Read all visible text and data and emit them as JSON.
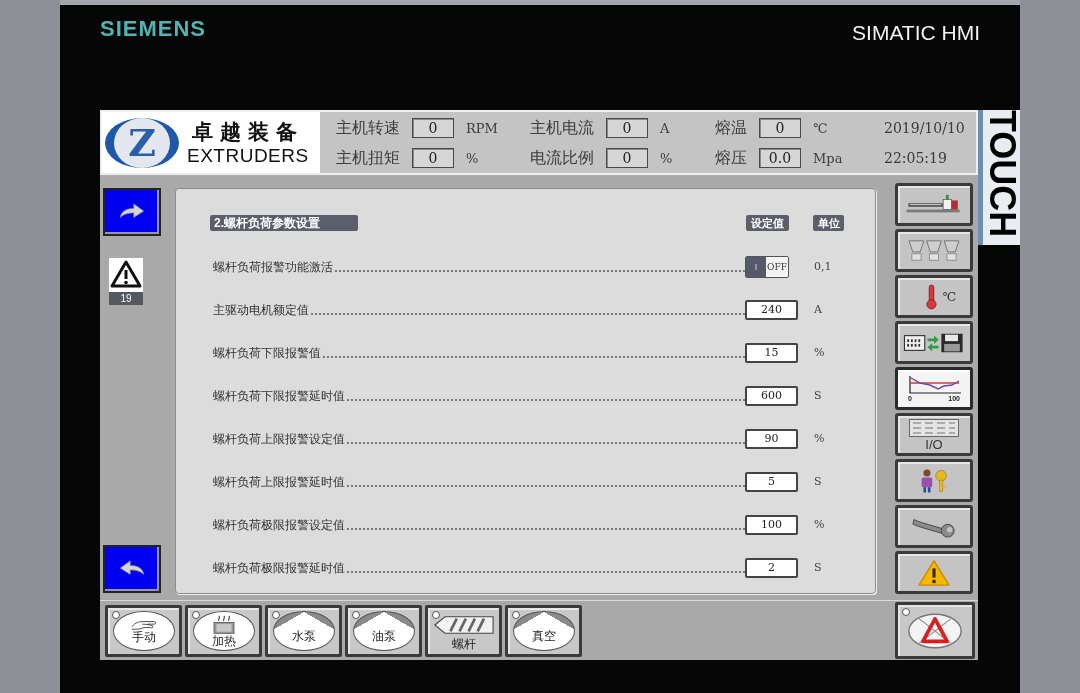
{
  "device": {
    "brand": "SIEMENS",
    "model": "SIMATIC HMI",
    "touch_label": "TOUCH"
  },
  "header": {
    "logo": {
      "mark": "Z",
      "name_cn": "卓越装备",
      "name_en": "EXTRUDERS"
    },
    "rows": [
      {
        "readings": [
          {
            "label": "主机转速",
            "value": "0",
            "unit": "RPM"
          },
          {
            "label": "主机电流",
            "value": "0",
            "unit": "A"
          },
          {
            "label": "熔温",
            "value": "0",
            "unit": "℃"
          }
        ],
        "clock": "2019/10/10"
      },
      {
        "readings": [
          {
            "label": "主机扭矩",
            "value": "0",
            "unit": "%"
          },
          {
            "label": "电流比例",
            "value": "0",
            "unit": "%"
          },
          {
            "label": "熔压",
            "value": "0.0",
            "unit": "Mpa"
          }
        ],
        "clock": "22:05:19"
      }
    ]
  },
  "left_nav": {
    "alarm_count": "19"
  },
  "panel": {
    "title": "2.螺杆负荷参数设置",
    "columns": [
      "设定值",
      "单位"
    ],
    "rows": [
      {
        "kind": "toggle",
        "label": "螺杆负荷报警功能激活",
        "on_text": "I",
        "off_text": "OFF",
        "on": false,
        "unit": "0,1"
      },
      {
        "kind": "value",
        "label": "主驱动电机额定值",
        "value": "240",
        "unit": "A"
      },
      {
        "kind": "value",
        "label": "螺杆负荷下限报警值",
        "value": "15",
        "unit": "%"
      },
      {
        "kind": "value",
        "label": "螺杆负荷下限报警延时值",
        "value": "600",
        "unit": "S"
      },
      {
        "kind": "value",
        "label": "螺杆负荷上限报警设定值",
        "value": "90",
        "unit": "%"
      },
      {
        "kind": "value",
        "label": "螺杆负荷上限报警延时值",
        "value": "5",
        "unit": "S"
      },
      {
        "kind": "value",
        "label": "螺杆负荷极限报警设定值",
        "value": "100",
        "unit": "%"
      },
      {
        "kind": "value",
        "label": "螺杆负荷极限报警延时值",
        "value": "2",
        "unit": "S"
      }
    ]
  },
  "right_nav": [
    {
      "kind": "extruder",
      "selected": false
    },
    {
      "kind": "hoppers",
      "selected": false
    },
    {
      "kind": "temperature",
      "selected": false,
      "label": "℃"
    },
    {
      "kind": "recipe",
      "selected": false
    },
    {
      "kind": "trend",
      "selected": true,
      "labels": [
        "0",
        "100"
      ]
    },
    {
      "kind": "io",
      "selected": false,
      "label": "I/O"
    },
    {
      "kind": "user",
      "selected": false
    },
    {
      "kind": "service",
      "selected": false
    },
    {
      "kind": "alarms",
      "selected": false
    }
  ],
  "bottom_bar": {
    "buttons": [
      {
        "kind": "hand",
        "label": "手动",
        "lamp_on": false
      },
      {
        "kind": "heater",
        "label": "加热",
        "lamp_on": false
      },
      {
        "kind": "pump",
        "label": "水泵",
        "lamp_on": false
      },
      {
        "kind": "pump",
        "label": "油泵",
        "lamp_on": false
      },
      {
        "kind": "screw",
        "label": "螺杆",
        "lamp_on": false
      },
      {
        "kind": "pump",
        "label": "真空",
        "lamp_on": false
      }
    ],
    "alarm_reset": {
      "lamp_on": false
    }
  }
}
